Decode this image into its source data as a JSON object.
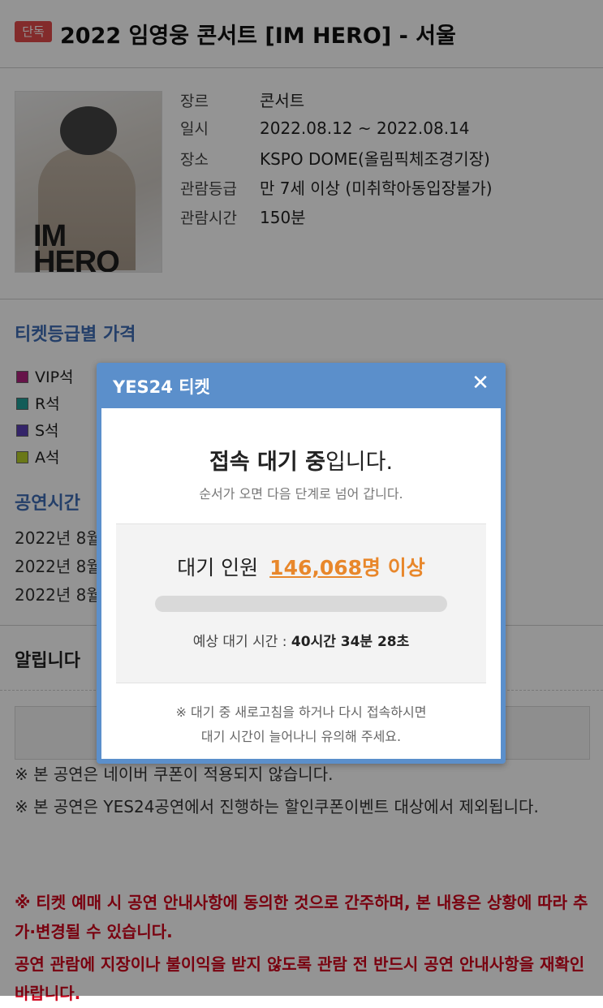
{
  "header": {
    "badge": "단독",
    "title": "2022 임영웅 콘서트 [IM HERO] - 서울"
  },
  "poster": {
    "text_line1": "IM",
    "text_line2": "HERO"
  },
  "info": [
    {
      "key": "장르",
      "value": "콘서트"
    },
    {
      "key": "일시",
      "value": "2022.08.12 ~ 2022.08.14"
    },
    {
      "key": "장소",
      "value": "KSPO DOME(올림픽체조경기장)"
    },
    {
      "key": "관람등급",
      "value": "만 7세 이상 (미취학아동입장불가)"
    },
    {
      "key": "관람시간",
      "value": "150분"
    }
  ],
  "price_section": {
    "title": "티켓등급별 가격",
    "grades": [
      {
        "label": "VIP석",
        "color": "#b0247f"
      },
      {
        "label": "R석",
        "color": "#1f9f98"
      },
      {
        "label": "S석",
        "color": "#5b3fb5"
      },
      {
        "label": "A석",
        "color": "#b7cf2a"
      }
    ]
  },
  "time_section": {
    "title": "공연시간",
    "rows": [
      "2022년 8월",
      "2022년 8월",
      "2022년 8월"
    ]
  },
  "notice": {
    "title": "알립니다",
    "line1": "※ 본 공연은 네이버 쿠폰이 적용되지 않습니다.",
    "line2": "※ 본 공연은 YES24공연에서 진행하는 할인쿠폰이벤트 대상에서 제외됩니다.",
    "red1": "※ 티켓 예매 시 공연 안내사항에 동의한 것으로 간주하며, 본 내용은 상황에 따라 추가·변경될 수 있습니다.",
    "red2": "공연 관람에 지장이나 불이익을 받지 않도록 관람 전 반드시 공연 안내사항을 재확인 바랍니다."
  },
  "modal": {
    "title": "YES24 티켓",
    "close_icon": "close-icon",
    "heading_bold": "접속 대기 중",
    "heading_rest": "입니다.",
    "subtitle": "순서가 오면 다음 단계로 넘어 갑니다.",
    "queue_label": "대기 인원",
    "queue_count": "146,068",
    "queue_suffix": "명 이상",
    "progress": 0,
    "eta_label": "예상 대기 시간 :",
    "eta_value": "40시간 34분 28초",
    "note_line1": "※ 대기 중 새로고침을 하거나 다시 접속하시면",
    "note_line2": "대기 시간이 늘어나니 유의해 주세요."
  },
  "colors": {
    "accent": "#3f6db5",
    "modal_header": "#5b8fcb",
    "queue": "#e8872b",
    "badge": "#e24b4b",
    "warning": "#d0021b"
  }
}
